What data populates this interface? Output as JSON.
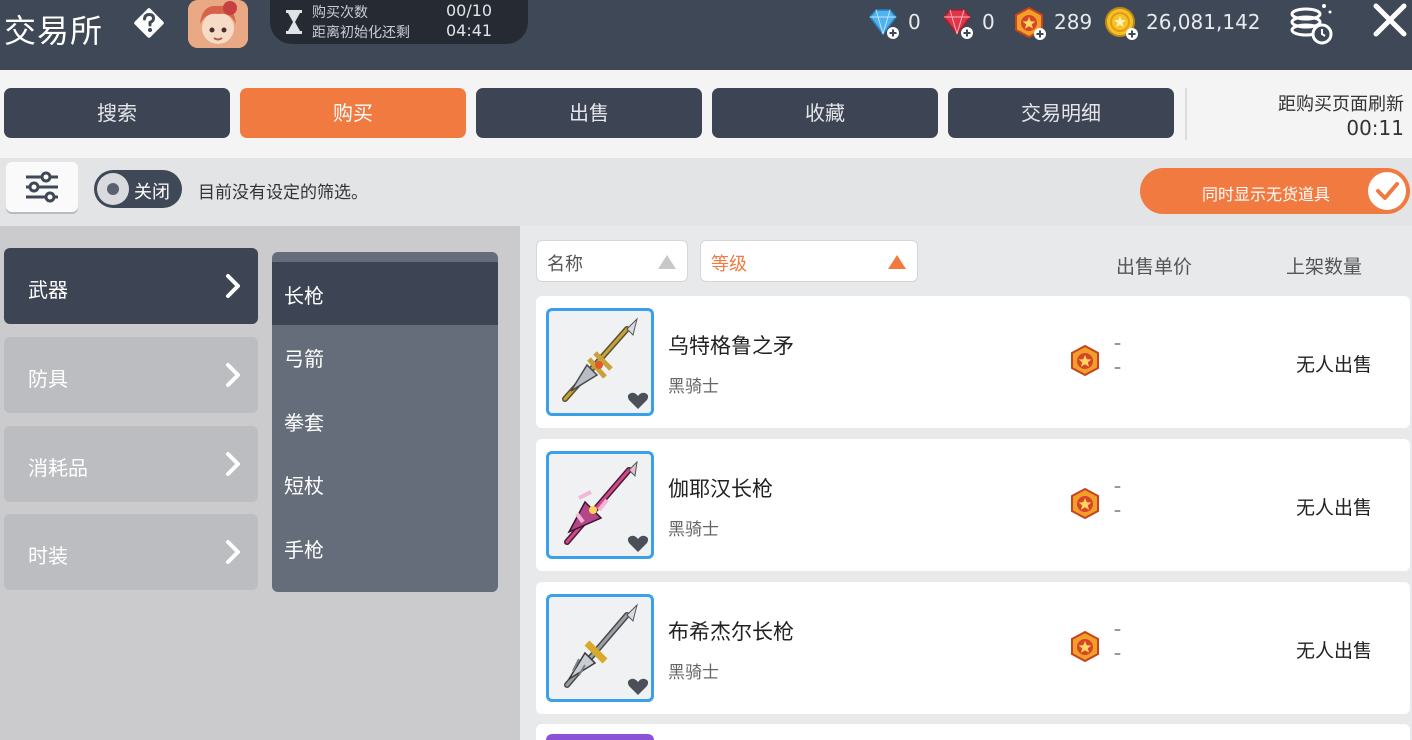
{
  "header": {
    "title": "交易所",
    "purchase_count_label": "购买次数",
    "purchase_count_value": "00/10",
    "reset_label": "距离初始化还剩",
    "reset_value": "04:41",
    "currencies": [
      {
        "icon": "blue-diamond-icon",
        "value": "0"
      },
      {
        "icon": "red-diamond-icon",
        "value": "0"
      },
      {
        "icon": "star-token-icon",
        "value": "289"
      },
      {
        "icon": "gold-coin-icon",
        "value": "26,081,142"
      }
    ]
  },
  "tabs": [
    {
      "label": "搜索",
      "active": false
    },
    {
      "label": "购买",
      "active": true
    },
    {
      "label": "出售",
      "active": false
    },
    {
      "label": "收藏",
      "active": false
    },
    {
      "label": "交易明细",
      "active": false
    }
  ],
  "refresh": {
    "label": "距购买页面刷新",
    "time": "00:11"
  },
  "filter": {
    "toggle_label": "关闭",
    "status_text": "目前没有设定的筛选。",
    "show_out_of_stock_label": "同时显示无货道具",
    "show_out_of_stock_checked": true
  },
  "categories": [
    {
      "label": "武器",
      "active": true
    },
    {
      "label": "防具",
      "active": false
    },
    {
      "label": "消耗品",
      "active": false
    },
    {
      "label": "时装",
      "active": false
    }
  ],
  "subcategories": [
    {
      "label": "长枪",
      "active": true
    },
    {
      "label": "弓箭",
      "active": false
    },
    {
      "label": "拳套",
      "active": false
    },
    {
      "label": "短杖",
      "active": false
    },
    {
      "label": "手枪",
      "active": false
    }
  ],
  "list": {
    "sort_name_label": "名称",
    "sort_level_label": "等级",
    "col_price": "出售单价",
    "col_quantity": "上架数量",
    "items": [
      {
        "name": "乌特格鲁之矛",
        "class": "黑骑士",
        "price_line1": "–",
        "price_line2": "–",
        "status": "无人出售",
        "color": "#b8862a"
      },
      {
        "name": "伽耶汉长枪",
        "class": "黑骑士",
        "price_line1": "–",
        "price_line2": "–",
        "status": "无人出售",
        "color": "#c23a8a"
      },
      {
        "name": "布希杰尔长枪",
        "class": "黑骑士",
        "price_line1": "–",
        "price_line2": "–",
        "status": "无人出售",
        "color": "#8a8f99"
      }
    ]
  },
  "colors": {
    "accent": "#f07a40",
    "dark": "#3d4554",
    "header": "#3f4856"
  }
}
